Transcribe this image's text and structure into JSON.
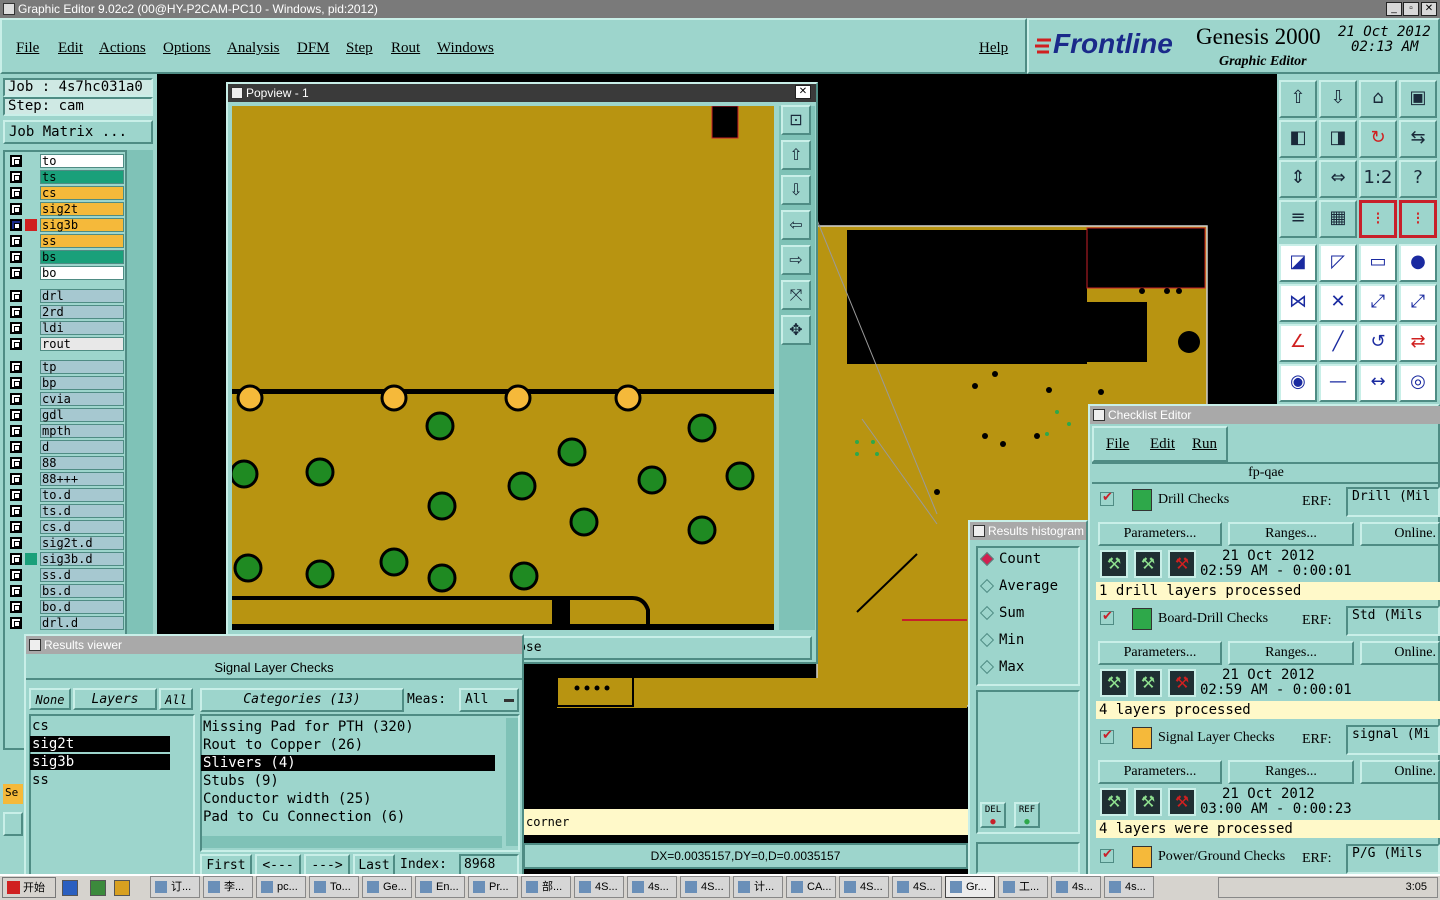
{
  "app": {
    "title": "Graphic Editor 9.02c2 (00@HY-P2CAM-PC10 - Windows, pid:2012)"
  },
  "menu": {
    "file": "File",
    "edit": "Edit",
    "actions": "Actions",
    "options": "Options",
    "analysis": "Analysis",
    "dfm": "DFM",
    "step": "Step",
    "rout": "Rout",
    "windows": "Windows",
    "help": "Help"
  },
  "brand": {
    "logo": "Frontline",
    "product": "Genesis 2000",
    "sub": "Graphic Editor",
    "date": "21 Oct 2012",
    "time": "02:13 AM"
  },
  "job": {
    "job_line": "Job : 4s7hc031a0",
    "step_line": "Step: cam",
    "matrix_button": "Job Matrix ..."
  },
  "layers": [
    {
      "name": "to",
      "color": "#ffffff"
    },
    {
      "name": "ts",
      "color": "#1aa07a"
    },
    {
      "name": "cs",
      "color": "#f5b93a"
    },
    {
      "name": "sig2t",
      "color": "#f5b93a"
    },
    {
      "name": "sig3b",
      "color": "#f5b93a"
    },
    {
      "name": "ss",
      "color": "#f5b93a"
    },
    {
      "name": "bs",
      "color": "#1aa07a"
    },
    {
      "name": "bo",
      "color": "#ffffff"
    },
    {
      "name": "drl",
      "color": "#a6c8d0"
    },
    {
      "name": "2rd",
      "color": "#a6c8d0"
    },
    {
      "name": "ldi",
      "color": "#a6c8d0"
    },
    {
      "name": "rout",
      "color": "#e8e8e8"
    },
    {
      "name": "tp",
      "color": "#a6c8d0"
    },
    {
      "name": "bp",
      "color": "#a6c8d0"
    },
    {
      "name": "cvia",
      "color": "#a6c8d0"
    },
    {
      "name": "gdl",
      "color": "#a6c8d0"
    },
    {
      "name": "mpth",
      "color": "#a6c8d0"
    },
    {
      "name": "d",
      "color": "#a6c8d0"
    },
    {
      "name": "88",
      "color": "#a6c8d0"
    },
    {
      "name": "88+++",
      "color": "#a6c8d0"
    },
    {
      "name": "to.d",
      "color": "#a6c8d0"
    },
    {
      "name": "ts.d",
      "color": "#a6c8d0"
    },
    {
      "name": "cs.d",
      "color": "#a6c8d0"
    },
    {
      "name": "sig2t.d",
      "color": "#a6c8d0"
    },
    {
      "name": "sig3b.d",
      "color": "#a6c8d0"
    },
    {
      "name": "ss.d",
      "color": "#a6c8d0"
    },
    {
      "name": "bs.d",
      "color": "#a6c8d0"
    },
    {
      "name": "bo.d",
      "color": "#a6c8d0"
    },
    {
      "name": "drl.d",
      "color": "#a6c8d0"
    }
  ],
  "popview": {
    "title": "Popview - 1",
    "close": "Close"
  },
  "results_viewer": {
    "title": "Results viewer",
    "heading": "Signal Layer Checks",
    "none": "None",
    "layers": "Layers",
    "all": "All",
    "categories_label": "Categories (13)",
    "meas_label": "Meas:",
    "meas_value": "All",
    "layer_items": [
      "cs",
      "sig2t",
      "sig3b",
      "ss"
    ],
    "categories": [
      "Missing Pad for PTH (320)",
      "Rout to Copper (26)",
      "Slivers (4)",
      "Stubs (9)",
      "Conductor width (25)",
      "Pad to Cu Connection (6)"
    ],
    "first": "First",
    "prev": "<---",
    "next": "--->",
    "last": "Last",
    "index_label": "Index:",
    "index_value": "8968"
  },
  "canvas": {
    "corner_label": "corner",
    "coords": "DX=0.0035157,DY=0,D=0.0035157"
  },
  "histogram": {
    "title": "Results histogram",
    "options": [
      "Count",
      "Average",
      "Sum",
      "Min",
      "Max"
    ],
    "del": "DEL",
    "ref": "REF"
  },
  "checklist": {
    "title": "Checklist Editor",
    "file": "File",
    "edit": "Edit",
    "run": "Run",
    "name": "fp-qae",
    "erf_label": "ERF:",
    "params": "Parameters...",
    "ranges": "Ranges...",
    "online": "Online.",
    "checks": [
      {
        "name": "Drill Checks",
        "erf": "Drill (Mil",
        "date": "21 Oct 2012",
        "time": "02:59 AM - 0:00:01",
        "status": "1 drill layers processed"
      },
      {
        "name": "Board-Drill Checks",
        "erf": "Std (Mils",
        "date": "21 Oct 2012",
        "time": "02:59 AM - 0:00:01",
        "status": "4 layers processed"
      },
      {
        "name": "Signal Layer Checks",
        "erf": "signal (Mi",
        "date": "21 Oct 2012",
        "time": "03:00 AM - 0:00:23",
        "status": "4 layers were processed"
      },
      {
        "name": "Power/Ground Checks",
        "erf": "P/G (Mils"
      }
    ]
  },
  "left_bottom": {
    "se": "Se"
  },
  "taskbar": {
    "start": "开始",
    "clock": "3:05",
    "tasks": [
      "订...",
      "李...",
      "pc...",
      "To...",
      "Ge...",
      "En...",
      "Pr...",
      "部...",
      "4S...",
      "4s...",
      "4S...",
      "计...",
      "CA...",
      "4S...",
      "4S...",
      "Gr...",
      "工...",
      "4s...",
      "4s..."
    ]
  }
}
